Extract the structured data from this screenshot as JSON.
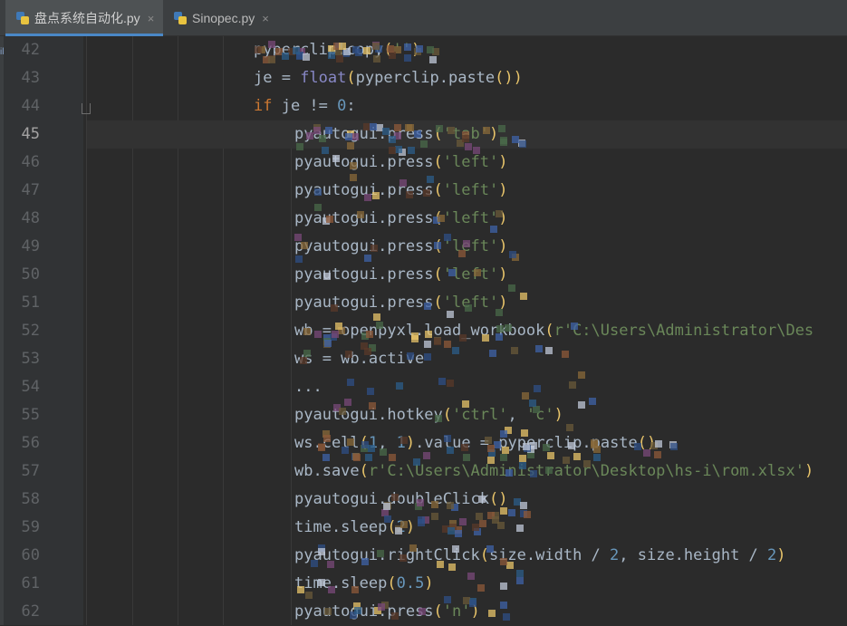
{
  "tabs": [
    {
      "label": "盘点系统自动化.py",
      "active": true,
      "icon": "python-file-icon"
    },
    {
      "label": "Sinopec.py",
      "active": false,
      "icon": "python-file-icon"
    }
  ],
  "close_glyph": "×",
  "left_strip_text": "il",
  "lines": [
    {
      "num": "42",
      "text": "pyperclip.copy('')"
    },
    {
      "num": "43",
      "text": "je = float(pyperclip.paste())"
    },
    {
      "num": "44",
      "text": "if je != 0:"
    },
    {
      "num": "45",
      "text": "pyautogui.press('tab')",
      "current": true
    },
    {
      "num": "46",
      "text": "pyautogui.press('left')"
    },
    {
      "num": "47",
      "text": "pyautogui.press('left')"
    },
    {
      "num": "48",
      "text": "pyautogui.press('left')"
    },
    {
      "num": "49",
      "text": "pyautogui.press('left')"
    },
    {
      "num": "50",
      "text": "pyautogui.press('left')"
    },
    {
      "num": "51",
      "text": "pyautogui.press('left')"
    },
    {
      "num": "52",
      "text": "wb = openpyxl.load_workbook(r'C:\\Users\\Administrator\\Des"
    },
    {
      "num": "53",
      "text": "ws = wb.active"
    },
    {
      "num": "54",
      "text": "..."
    },
    {
      "num": "55",
      "text": "pyautogui.hotkey('ctrl', 'c')"
    },
    {
      "num": "56",
      "text": "ws.cell(1, 1).value = pyperclip.paste()"
    },
    {
      "num": "57",
      "text": "wb.save(r'C:\\Users\\Administrator\\Desktop\\hs-i\\rom.xlsx')"
    },
    {
      "num": "58",
      "text": "pyautogui.doubleClick()"
    },
    {
      "num": "59",
      "text": "time.sleep(2)"
    },
    {
      "num": "60",
      "text": "pyautogui.rightClick(size.width / 2, size.height / 2)"
    },
    {
      "num": "61",
      "text": "time.sleep(0.5)"
    },
    {
      "num": "62",
      "text": "pyautogui.press('n')"
    }
  ],
  "colors": {
    "background": "#2b2b2b",
    "gutter": "#313335",
    "tab_active_underline": "#4a88c7",
    "keyword": "#cc7832",
    "string": "#6a8759",
    "number": "#6897bb",
    "paren": "#e8c46a",
    "text": "#a9b7c6"
  }
}
